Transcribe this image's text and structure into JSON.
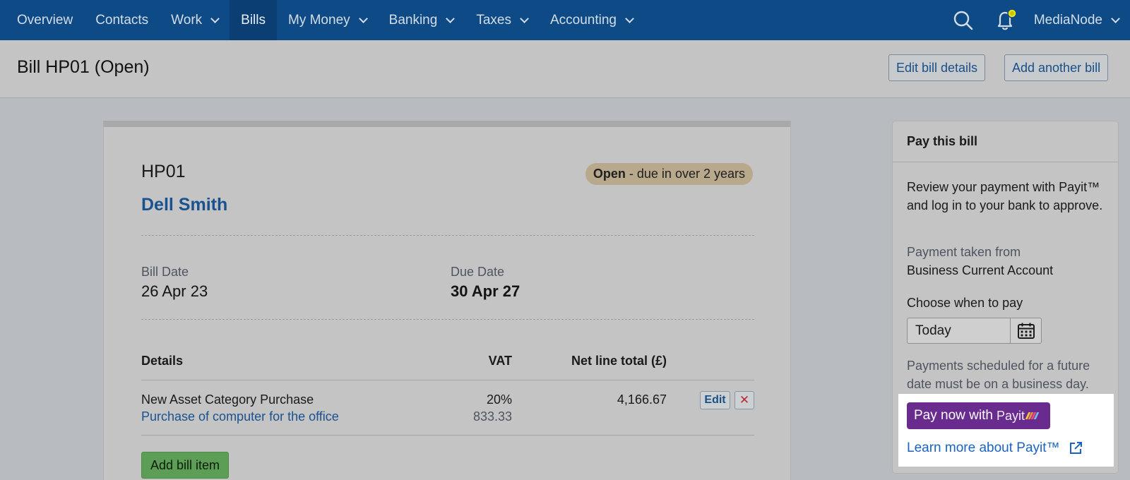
{
  "nav": {
    "items": [
      {
        "label": "Overview",
        "dropdown": false,
        "active": false
      },
      {
        "label": "Contacts",
        "dropdown": false,
        "active": false
      },
      {
        "label": "Work",
        "dropdown": true,
        "active": false
      },
      {
        "label": "Bills",
        "dropdown": false,
        "active": true
      },
      {
        "label": "My Money",
        "dropdown": true,
        "active": false
      },
      {
        "label": "Banking",
        "dropdown": true,
        "active": false
      },
      {
        "label": "Taxes",
        "dropdown": true,
        "active": false
      },
      {
        "label": "Accounting",
        "dropdown": true,
        "active": false
      }
    ],
    "account": "MediaNode"
  },
  "header": {
    "title": "Bill HP01 (Open)",
    "edit_label": "Edit bill details",
    "add_label": "Add another bill"
  },
  "bill": {
    "reference": "HP01",
    "contact": "Dell Smith",
    "status_strong": "Open",
    "status_rest": "- due in over 2 years",
    "bill_date_label": "Bill Date",
    "bill_date": "26 Apr 23",
    "due_date_label": "Due Date",
    "due_date": "30 Apr 27",
    "columns": {
      "details": "Details",
      "vat": "VAT",
      "net": "Net line total (£)"
    },
    "items": [
      {
        "category": "New Asset Category Purchase",
        "description": "Purchase of computer for the office",
        "vat_rate": "20%",
        "vat_amount": "833.33",
        "net_total": "4,166.67",
        "edit_label": "Edit",
        "delete_symbol": "✕"
      }
    ],
    "add_item_label": "Add bill item"
  },
  "pay": {
    "title": "Pay this bill",
    "intro": "Review your payment with Payit™ and log in to your bank to approve.",
    "taken_from_label": "Payment taken from",
    "account": "Business Current Account",
    "choose_label": "Choose when to pay",
    "when_value": "Today",
    "note": "Payments scheduled for a future date must be on a business day.",
    "button_label": "Pay now with",
    "brand": "Payit",
    "learn_more": "Learn more about Payit™"
  },
  "colors": {
    "nav_bg": "#0d4a86",
    "link": "#1a5290",
    "payit_purple": "#6a2b8f",
    "add_green": "#5c9e55",
    "status_pill": "#b8a98c",
    "notification_dot": "#e8e21a"
  },
  "icons": {
    "search": "search-icon",
    "notifications": "bell-icon",
    "calendar": "calendar-icon",
    "external": "external-link-icon"
  }
}
